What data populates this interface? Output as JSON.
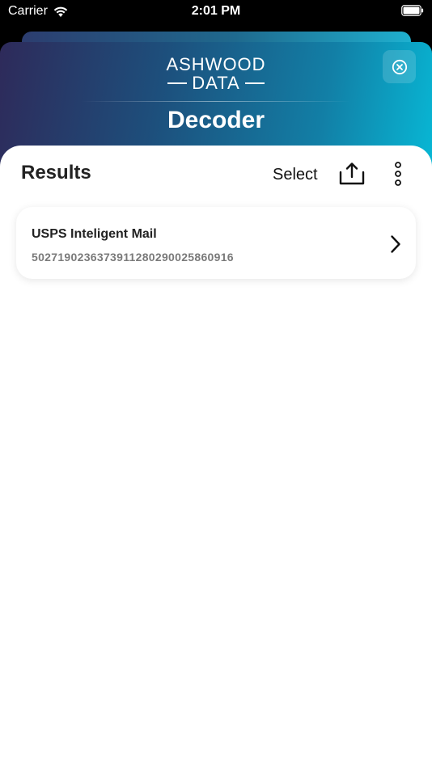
{
  "status_bar": {
    "carrier": "Carrier",
    "time": "2:01 PM",
    "wifi_icon": "wifi-icon",
    "battery_icon": "battery-icon"
  },
  "header": {
    "logo_top": "ASHWOOD",
    "logo_bottom": "DATA",
    "title": "Decoder",
    "close_icon": "close-circle-icon"
  },
  "toolbar": {
    "heading": "Results",
    "select_label": "Select",
    "share_icon": "share-icon",
    "more_icon": "more-vertical-icon"
  },
  "results": [
    {
      "type": "USPS Inteligent Mail",
      "value": "50271902363739112802900258609​16"
    }
  ],
  "colors": {
    "gradient_start": "#2e2a5a",
    "gradient_end": "#00dbf0",
    "panel": "#ffffff",
    "text_primary": "#222222",
    "text_secondary": "#7a7a7a"
  }
}
